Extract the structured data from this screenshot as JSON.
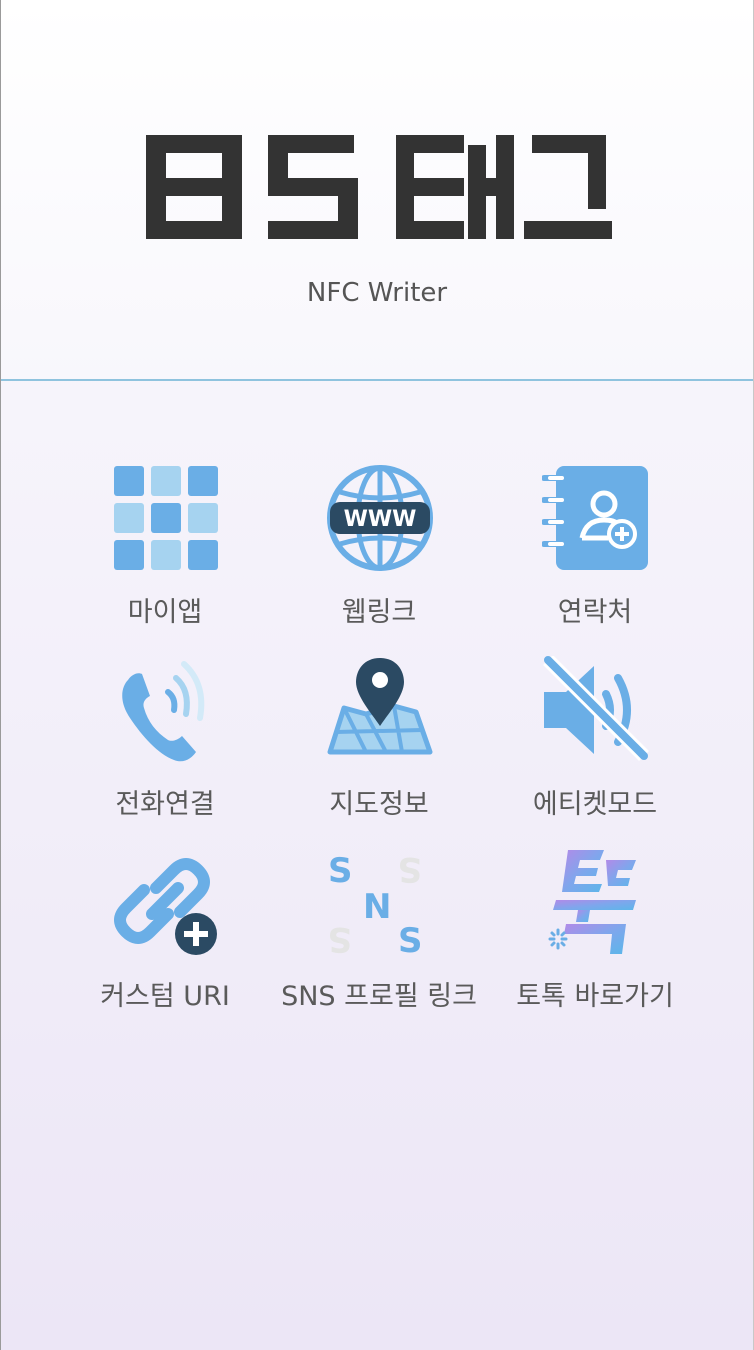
{
  "brand": {
    "logo_text": "BS 태그",
    "subtitle": "NFC Writer"
  },
  "colors": {
    "accent_blue": "#6aaee6",
    "light_blue": "#a6d3f0",
    "dark_navy": "#2b4a63",
    "divider": "#8fc3de",
    "label_text": "#5a5a5a",
    "logo_text": "#333333"
  },
  "menu": {
    "items": [
      {
        "label": "마이앱",
        "icon": "grid-icon"
      },
      {
        "label": "웹링크",
        "icon": "globe-www-icon"
      },
      {
        "label": "연락처",
        "icon": "contact-book-icon"
      },
      {
        "label": "전화연결",
        "icon": "phone-call-icon"
      },
      {
        "label": "지도정보",
        "icon": "map-pin-icon"
      },
      {
        "label": "에티켓모드",
        "icon": "mute-speaker-icon"
      },
      {
        "label": "커스텀 URI",
        "icon": "link-add-icon"
      },
      {
        "label": "SNS 프로필 링크",
        "icon": "sns-icon"
      },
      {
        "label": "토톡 바로가기",
        "icon": "totok-icon"
      }
    ]
  }
}
